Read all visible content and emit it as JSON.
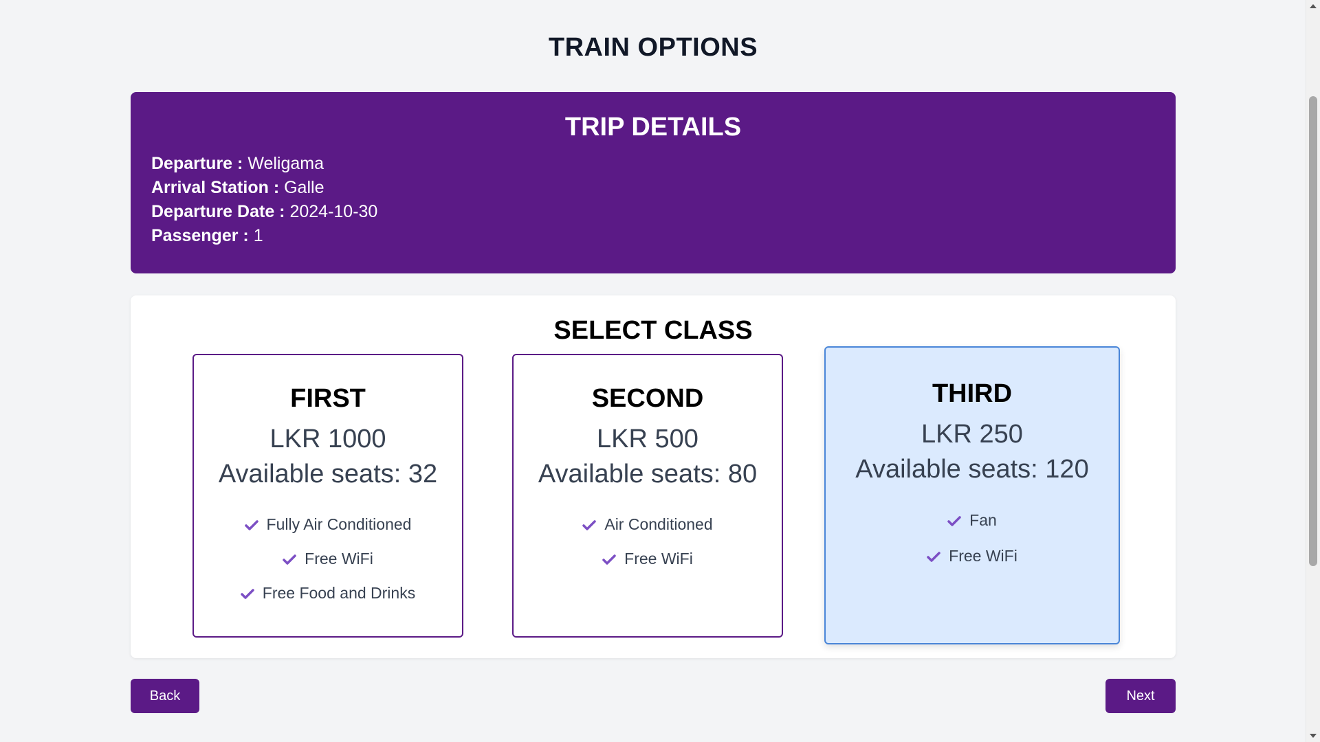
{
  "page_title": "TRAIN OPTIONS",
  "trip": {
    "title": "TRIP DETAILS",
    "rows": [
      {
        "label": "Departure :",
        "value": "Weligama"
      },
      {
        "label": "Arrival Station :",
        "value": "Galle"
      },
      {
        "label": "Departure Date :",
        "value": "2024-10-30"
      },
      {
        "label": "Passenger :",
        "value": "1"
      }
    ]
  },
  "select_class": {
    "title": "SELECT CLASS",
    "selected": "THIRD",
    "classes": [
      {
        "name": "FIRST",
        "price": "LKR 1000",
        "seats": "Available seats: 32",
        "features": [
          "Fully Air Conditioned",
          "Free WiFi",
          "Free Food and Drinks"
        ]
      },
      {
        "name": "SECOND",
        "price": "LKR 500",
        "seats": "Available seats: 80",
        "features": [
          "Air Conditioned",
          "Free WiFi"
        ]
      },
      {
        "name": "THIRD",
        "price": "LKR 250",
        "seats": "Available seats: 120",
        "features": [
          "Fan",
          "Free WiFi"
        ]
      }
    ]
  },
  "buttons": {
    "back": "Back",
    "next": "Next"
  },
  "icons": {
    "feature": "check-icon"
  },
  "colors": {
    "primary": "#5b1a86",
    "selected_bg": "#dbeafe",
    "selected_border": "#4a86d8",
    "check": "#7c4fc4"
  }
}
